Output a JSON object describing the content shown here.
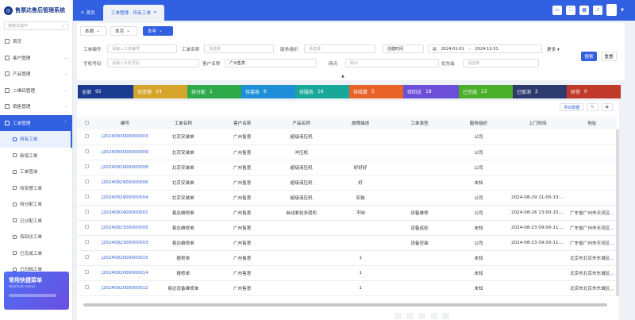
{
  "app": {
    "title": "售票达售后管理系统"
  },
  "sidebar": {
    "search_placeholder": "搜索关键字",
    "items": [
      {
        "label": "首页",
        "icon": "home-icon"
      },
      {
        "label": "客户管理",
        "icon": "user-icon"
      },
      {
        "label": "产品管理",
        "icon": "box-icon"
      },
      {
        "label": "二维码管理",
        "icon": "qrcode-icon"
      },
      {
        "label": "销售管理",
        "icon": "cart-icon"
      },
      {
        "label": "工单管理",
        "icon": "list-icon"
      }
    ],
    "sub_items": [
      {
        "label": "所有工单"
      },
      {
        "label": "新增工单"
      },
      {
        "label": "工单查询"
      },
      {
        "label": "待受理工单"
      },
      {
        "label": "待分配工单"
      },
      {
        "label": "已分配工单"
      },
      {
        "label": "待回访工单"
      },
      {
        "label": "已完成工单"
      },
      {
        "label": "已归档工单"
      }
    ],
    "quick": {
      "title": "常用快捷菜单",
      "subtitle": "shortcut menu"
    }
  },
  "topbar": {
    "tabs": [
      {
        "label": "首页"
      },
      {
        "label": "工单管理 - 所有工单"
      }
    ]
  },
  "filters": {
    "periods": [
      "本周",
      "本月",
      "本年"
    ],
    "order_no_label": "工单编号",
    "order_no_placeholder": "请输入工单编号",
    "order_name_label": "工单名称",
    "order_name_placeholder": "请选择",
    "service_org_label": "服务组织",
    "service_org_placeholder": "请选择",
    "date_type": "创建时间",
    "date_from": "2024-01-01",
    "date_to": "2024-12-31",
    "more": "更多",
    "phone_label": "手机号码",
    "phone_placeholder": "请输入手机号码",
    "customer_label": "客户名称",
    "customer_value": "广州售意",
    "site_label": "网点",
    "site_placeholder": "网点",
    "priority_label": "优先级",
    "priority_placeholder": "请选择",
    "search_btn": "搜索",
    "reset_btn": "重置"
  },
  "stats": [
    {
      "label": "全部",
      "count": "95",
      "color": "#1a3a8f"
    },
    {
      "label": "待受理",
      "count": "24",
      "color": "#d4a52a"
    },
    {
      "label": "待分配",
      "count": "1",
      "color": "#2eaa4a"
    },
    {
      "label": "待接收",
      "count": "6",
      "color": "#1e8fd6"
    },
    {
      "label": "待服务",
      "count": "16",
      "color": "#18a89a"
    },
    {
      "label": "待结算",
      "count": "5",
      "color": "#e8622a"
    },
    {
      "label": "待回访",
      "count": "18",
      "color": "#6b4fd8"
    },
    {
      "label": "已完成",
      "count": "23",
      "color": "#4caf2a"
    },
    {
      "label": "已取消",
      "count": "2",
      "color": "#2d3a6e"
    },
    {
      "label": "异常",
      "count": "0",
      "color": "#c0392b"
    }
  ],
  "table": {
    "export": "导出数据",
    "columns": [
      "编号",
      "工单名称",
      "客户名称",
      "产品名称",
      "故障描述",
      "工单类型",
      "服务组织",
      "上门时间",
      "地址"
    ],
    "rows": [
      [
        "J2024083000000003",
        "北京安装单",
        "广州售意",
        "超级液压机",
        "",
        "",
        "公司",
        "",
        ""
      ],
      [
        "J2024083000000009",
        "北京安装单",
        "广州售意",
        "冲压机",
        "",
        "",
        "公司",
        "",
        ""
      ],
      [
        "J2024082900000008",
        "北京安装单",
        "广州售意",
        "超级液压机",
        "好好好",
        "",
        "公司",
        "",
        ""
      ],
      [
        "J2024082900000006",
        "北京安装单",
        "广州售意",
        "超级液压机",
        "好",
        "",
        "未知",
        "",
        ""
      ],
      [
        "J2024082900000004",
        "北京安装单",
        "广州售意",
        "超级液压机",
        "安装",
        "",
        "公司",
        "2024-08-29 11:00-13:...",
        ""
      ],
      [
        "J2024082400000001",
        "易达维修单",
        "广州售意",
        "自动面包多层机",
        "不响",
        "设备维修",
        "公司",
        "2024-08-26 13:00-15:...",
        "广东省广州市天河区..."
      ],
      [
        "J2024082300000005",
        "易达维修单",
        "广州售意",
        "",
        "",
        "设备巡检",
        "未知",
        "2024-08-23 09:00-11:...",
        "广东省广州市天河区..."
      ],
      [
        "J2024082300000003",
        "易达维修单",
        "广州售意",
        "",
        "",
        "设备安装",
        "公司",
        "2024-08-23 09:00-11:...",
        "广东省广州市天河区..."
      ],
      [
        "J2024082000000015",
        "报修单",
        "广州售意",
        "",
        "1",
        "",
        "未知",
        "",
        "北京市北京市东城区..."
      ],
      [
        "J2024082000000014",
        "报修单",
        "广州售意",
        "",
        "1",
        "",
        "未知",
        "",
        "北京市北京市东城区..."
      ],
      [
        "J2024082000000012",
        "易达设备维修单",
        "广州售意",
        "",
        "1",
        "",
        "未知",
        "",
        "北京市北京市东城区..."
      ]
    ]
  }
}
